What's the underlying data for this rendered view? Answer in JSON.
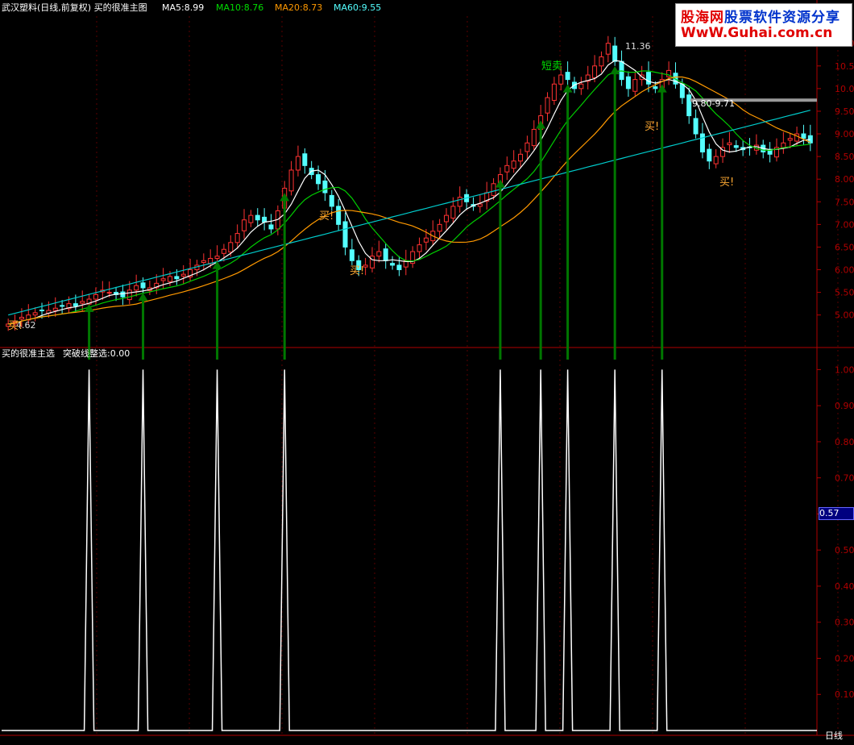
{
  "header": {
    "title": "武汉塑料(日线,前复权) 买的很准主图",
    "ma5": "MA5:8.99",
    "ma10": "MA10:8.76",
    "ma20": "MA20:8.73",
    "ma60": "MA60:9.55"
  },
  "sub_header": {
    "title": "买的很准主选",
    "indicator": "突破线整选:0.00"
  },
  "watermark": {
    "line1_a": "股海网",
    "line1_b": "股票软件资源分享",
    "line2": "WwW.Guhai.com.cn"
  },
  "annotations": {
    "high_label": "11.36",
    "low_label": "4.62",
    "range_label": "9.80-9.71",
    "short_sell": "短卖",
    "buy_labels": [
      "买!",
      "买!",
      "买!",
      "买!",
      "买!"
    ]
  },
  "side_badge": "0.57",
  "bottom": {
    "period": "日线"
  },
  "colors": {
    "up": "#ff3232",
    "down": "#54ffff",
    "ma5": "#ffffff",
    "ma10": "#00cc00",
    "ma20": "#ff9900",
    "ma60": "#00cccc",
    "axis": "#b00000",
    "arrow": "#007700"
  },
  "chart_data": [
    {
      "type": "candlestick",
      "title": "武汉塑料(日线,前复权) 买的很准主图",
      "y_ticks": [
        5.0,
        5.5,
        6.0,
        6.5,
        7.0,
        7.5,
        8.0,
        8.5,
        9.0,
        9.5,
        10.0,
        10.5,
        11.0
      ],
      "ylim": [
        4.3,
        11.6
      ],
      "close": [
        4.8,
        4.85,
        4.95,
        5.0,
        5.05,
        5.1,
        5.1,
        5.15,
        5.2,
        5.25,
        5.2,
        5.3,
        5.35,
        5.45,
        5.55,
        5.5,
        5.45,
        5.4,
        5.55,
        5.65,
        5.6,
        5.6,
        5.7,
        5.8,
        5.85,
        5.8,
        5.9,
        6.0,
        6.1,
        6.2,
        6.25,
        6.3,
        6.45,
        6.6,
        6.8,
        7.1,
        7.2,
        7.1,
        7.05,
        6.9,
        7.3,
        7.8,
        8.2,
        8.5,
        8.3,
        8.1,
        7.9,
        7.7,
        7.4,
        7.0,
        6.5,
        6.2,
        6.0,
        6.1,
        6.3,
        6.4,
        6.2,
        6.1,
        6.0,
        6.2,
        6.4,
        6.55,
        6.7,
        6.85,
        7.0,
        7.2,
        7.4,
        7.6,
        7.5,
        7.4,
        7.45,
        7.7,
        7.9,
        8.1,
        8.3,
        8.4,
        8.55,
        8.8,
        9.1,
        9.4,
        9.8,
        10.1,
        10.3,
        10.2,
        10.0,
        10.1,
        10.3,
        10.5,
        10.7,
        11.0,
        10.6,
        10.2,
        10.0,
        10.2,
        10.3,
        10.1,
        10.0,
        10.2,
        10.4,
        10.1,
        9.8,
        9.4,
        9.0,
        8.6,
        8.4,
        8.5,
        8.7,
        8.8,
        8.7,
        8.65,
        8.7,
        8.75,
        8.6,
        8.55,
        8.7,
        8.8,
        8.9,
        9.0,
        8.9,
        8.8
      ],
      "ma5_last": 8.99,
      "ma10_last": 8.76,
      "ma20_last": 8.73,
      "ma60_last": 9.55,
      "high_marker": 11.36,
      "low_marker": 4.62
    },
    {
      "type": "line",
      "title": "买的很准主选",
      "y_ticks": [
        0.1,
        0.2,
        0.3,
        0.4,
        0.5,
        0.6,
        0.7,
        0.8,
        0.9,
        1.0
      ],
      "ylim": [
        0,
        1.05
      ],
      "signal_bars": [
        12,
        20,
        31,
        41,
        73,
        79,
        83,
        90,
        97
      ]
    }
  ]
}
